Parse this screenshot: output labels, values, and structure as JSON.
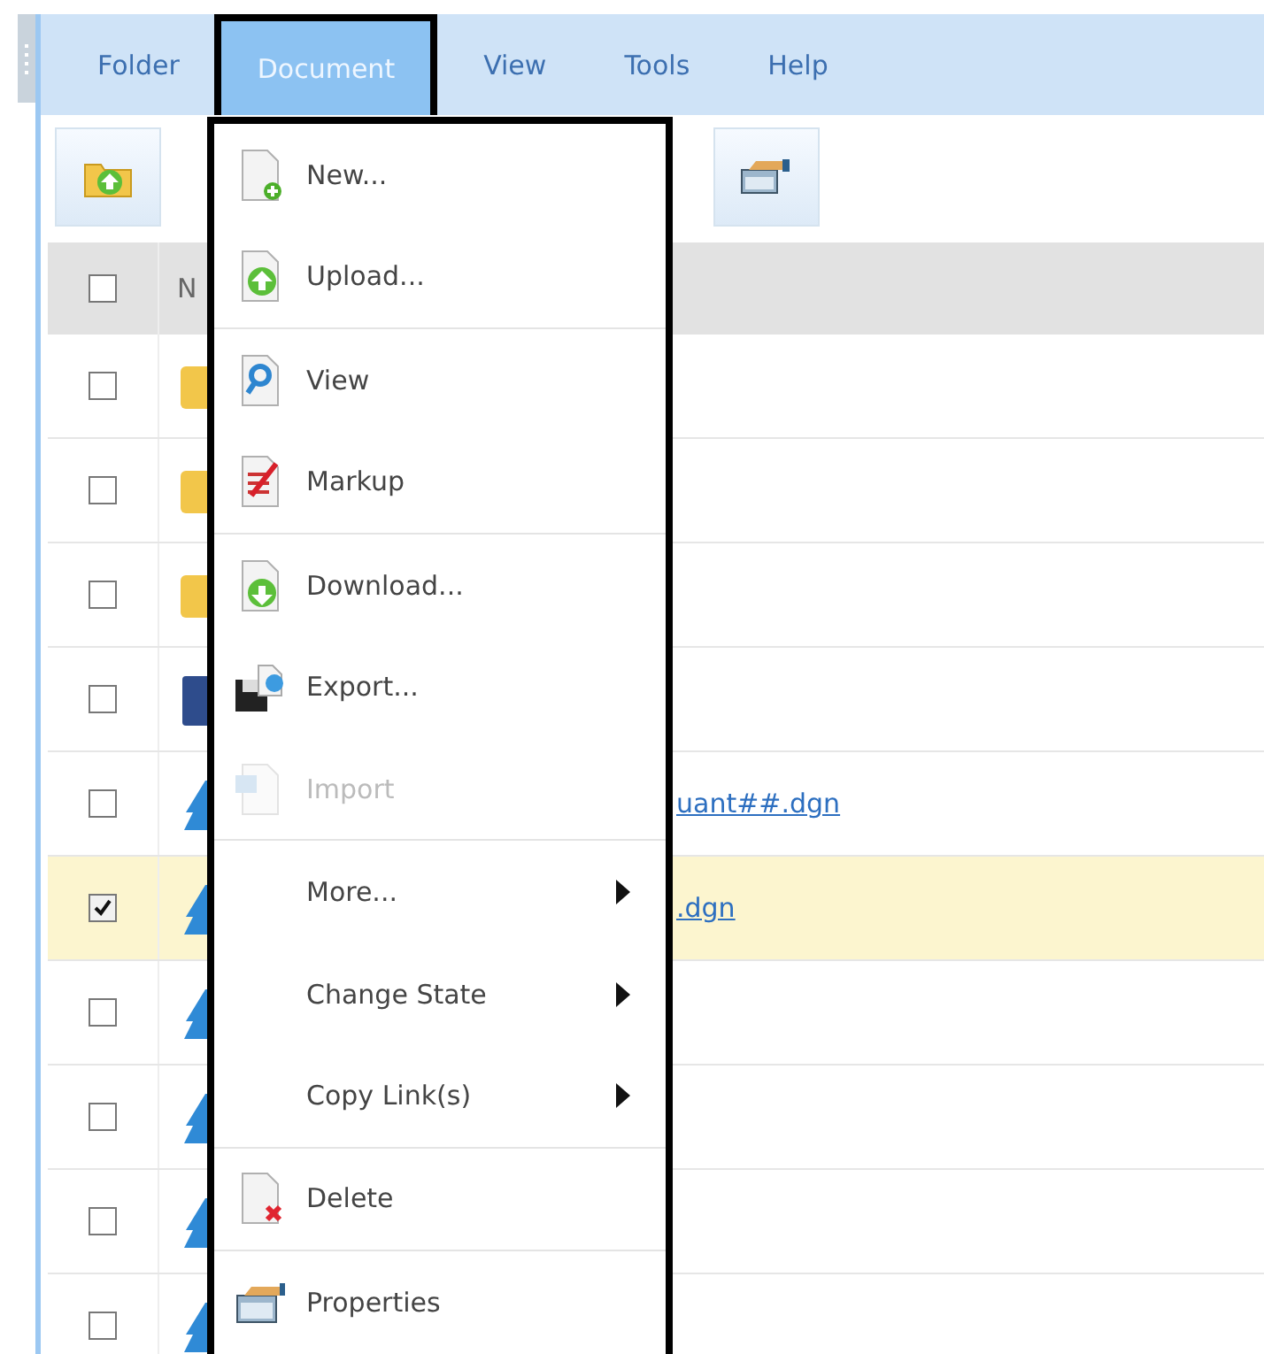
{
  "menubar": [
    {
      "label": "Folder",
      "selected": false
    },
    {
      "label": "Document",
      "selected": true
    },
    {
      "label": "View",
      "selected": false
    },
    {
      "label": "Tools",
      "selected": false
    },
    {
      "label": "Help",
      "selected": false
    }
  ],
  "table": {
    "header": "N",
    "header_checked": false,
    "rows": [
      {
        "kind": "folder",
        "checked": false,
        "selected": false
      },
      {
        "kind": "folder",
        "checked": false,
        "selected": false
      },
      {
        "kind": "folder",
        "checked": false,
        "selected": false
      },
      {
        "kind": "book",
        "checked": false,
        "selected": false
      },
      {
        "kind": "drawing",
        "checked": false,
        "selected": false,
        "name": "uant##.dgn"
      },
      {
        "kind": "drawing",
        "checked": true,
        "selected": true,
        "name": ".dgn"
      },
      {
        "kind": "drawing",
        "checked": false,
        "selected": false
      },
      {
        "kind": "drawing",
        "checked": false,
        "selected": false
      },
      {
        "kind": "drawing",
        "checked": false,
        "selected": false
      },
      {
        "kind": "drawing",
        "checked": false,
        "selected": false
      }
    ]
  },
  "menu": [
    {
      "label": "New...",
      "disabled": false,
      "submenu": false,
      "divider_after": false
    },
    {
      "label": "Upload...",
      "disabled": false,
      "submenu": false,
      "divider_after": true
    },
    {
      "label": "View",
      "disabled": false,
      "submenu": false,
      "divider_after": false
    },
    {
      "label": "Markup",
      "disabled": false,
      "submenu": false,
      "divider_after": true
    },
    {
      "label": "Download...",
      "disabled": false,
      "submenu": false,
      "divider_after": false
    },
    {
      "label": "Export...",
      "disabled": false,
      "submenu": false,
      "divider_after": false
    },
    {
      "label": "Import",
      "disabled": true,
      "submenu": false,
      "divider_after": true
    },
    {
      "label": "More...",
      "disabled": false,
      "submenu": true,
      "divider_after": false
    },
    {
      "label": "Change State",
      "disabled": false,
      "submenu": true,
      "divider_after": false
    },
    {
      "label": "Copy Link(s)",
      "disabled": false,
      "submenu": true,
      "divider_after": true
    },
    {
      "label": "Delete",
      "disabled": false,
      "submenu": false,
      "divider_after": true
    },
    {
      "label": "Properties",
      "disabled": false,
      "submenu": false,
      "divider_after": false
    }
  ]
}
